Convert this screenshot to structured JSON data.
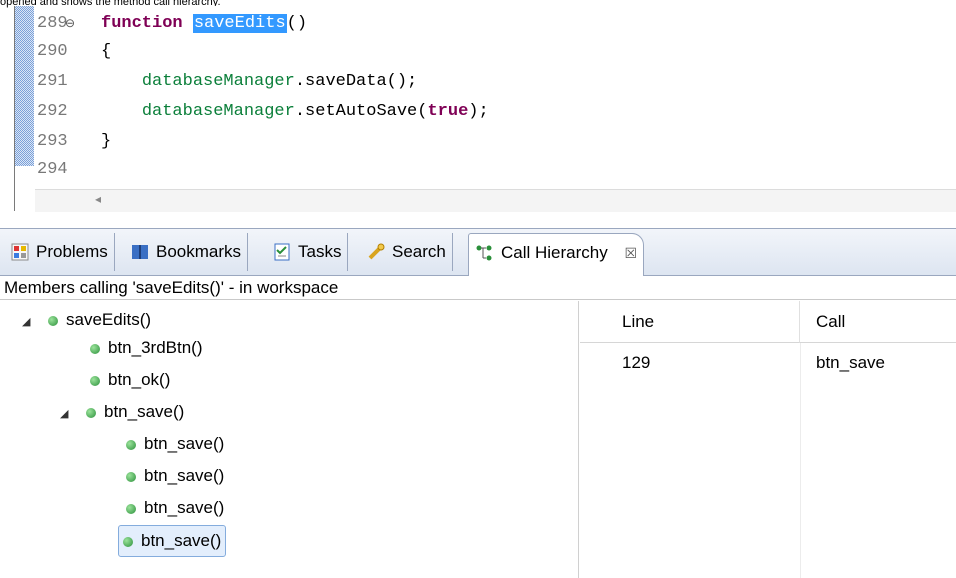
{
  "caption": "opened and shows the method call hierarchy.",
  "editor": {
    "lines": [
      {
        "num": "289",
        "fold": "⊖",
        "tokens": [
          {
            "t": "kw",
            "v": "function"
          },
          {
            "t": "sp",
            "v": " "
          },
          {
            "t": "hl",
            "v": "saveEdits"
          },
          {
            "t": "plain",
            "v": "()"
          }
        ]
      },
      {
        "num": "290",
        "tokens": [
          {
            "t": "plain",
            "v": "{"
          }
        ]
      },
      {
        "num": "291",
        "tokens": [
          {
            "t": "plain",
            "v": "    "
          },
          {
            "t": "obj",
            "v": "databaseManager"
          },
          {
            "t": "plain",
            "v": ".saveData();"
          }
        ]
      },
      {
        "num": "292",
        "tokens": [
          {
            "t": "plain",
            "v": "    "
          },
          {
            "t": "obj",
            "v": "databaseManager"
          },
          {
            "t": "plain",
            "v": ".setAutoSave("
          },
          {
            "t": "kw",
            "v": "true"
          },
          {
            "t": "plain",
            "v": ");"
          }
        ]
      },
      {
        "num": "293",
        "tokens": [
          {
            "t": "plain",
            "v": "}"
          }
        ]
      },
      {
        "num": "294",
        "tokens": []
      }
    ],
    "scroll_arrow": "◂"
  },
  "tabs": [
    {
      "label": "Problems",
      "icon": "problems-icon"
    },
    {
      "label": "Bookmarks",
      "icon": "bookmarks-icon"
    },
    {
      "label": "Tasks",
      "icon": "tasks-icon"
    },
    {
      "label": "Search",
      "icon": "search-icon"
    },
    {
      "label": "Call Hierarchy",
      "icon": "call-hierarchy-icon",
      "active": true,
      "close": "☒"
    }
  ],
  "status": "Members calling 'saveEdits()' - in workspace",
  "tree": [
    {
      "label": "saveEdits()",
      "level": 0,
      "expanded": true
    },
    {
      "label": "btn_3rdBtn()",
      "level": 1
    },
    {
      "label": "btn_ok()",
      "level": 1
    },
    {
      "label": "btn_save()",
      "level": 1,
      "expanded": true
    },
    {
      "label": "btn_save()",
      "level": 2
    },
    {
      "label": "btn_save()",
      "level": 2
    },
    {
      "label": "btn_save()",
      "level": 2
    },
    {
      "label": "btn_save()",
      "level": 2,
      "selected": true
    }
  ],
  "table": {
    "headers": [
      "Line",
      "Call"
    ],
    "rows": [
      [
        "129",
        "btn_save"
      ]
    ]
  },
  "colors": {
    "keyword": "#7f0055",
    "object": "#0b7f3a",
    "highlight": "#3399ff",
    "selection": "#e3eefc"
  }
}
